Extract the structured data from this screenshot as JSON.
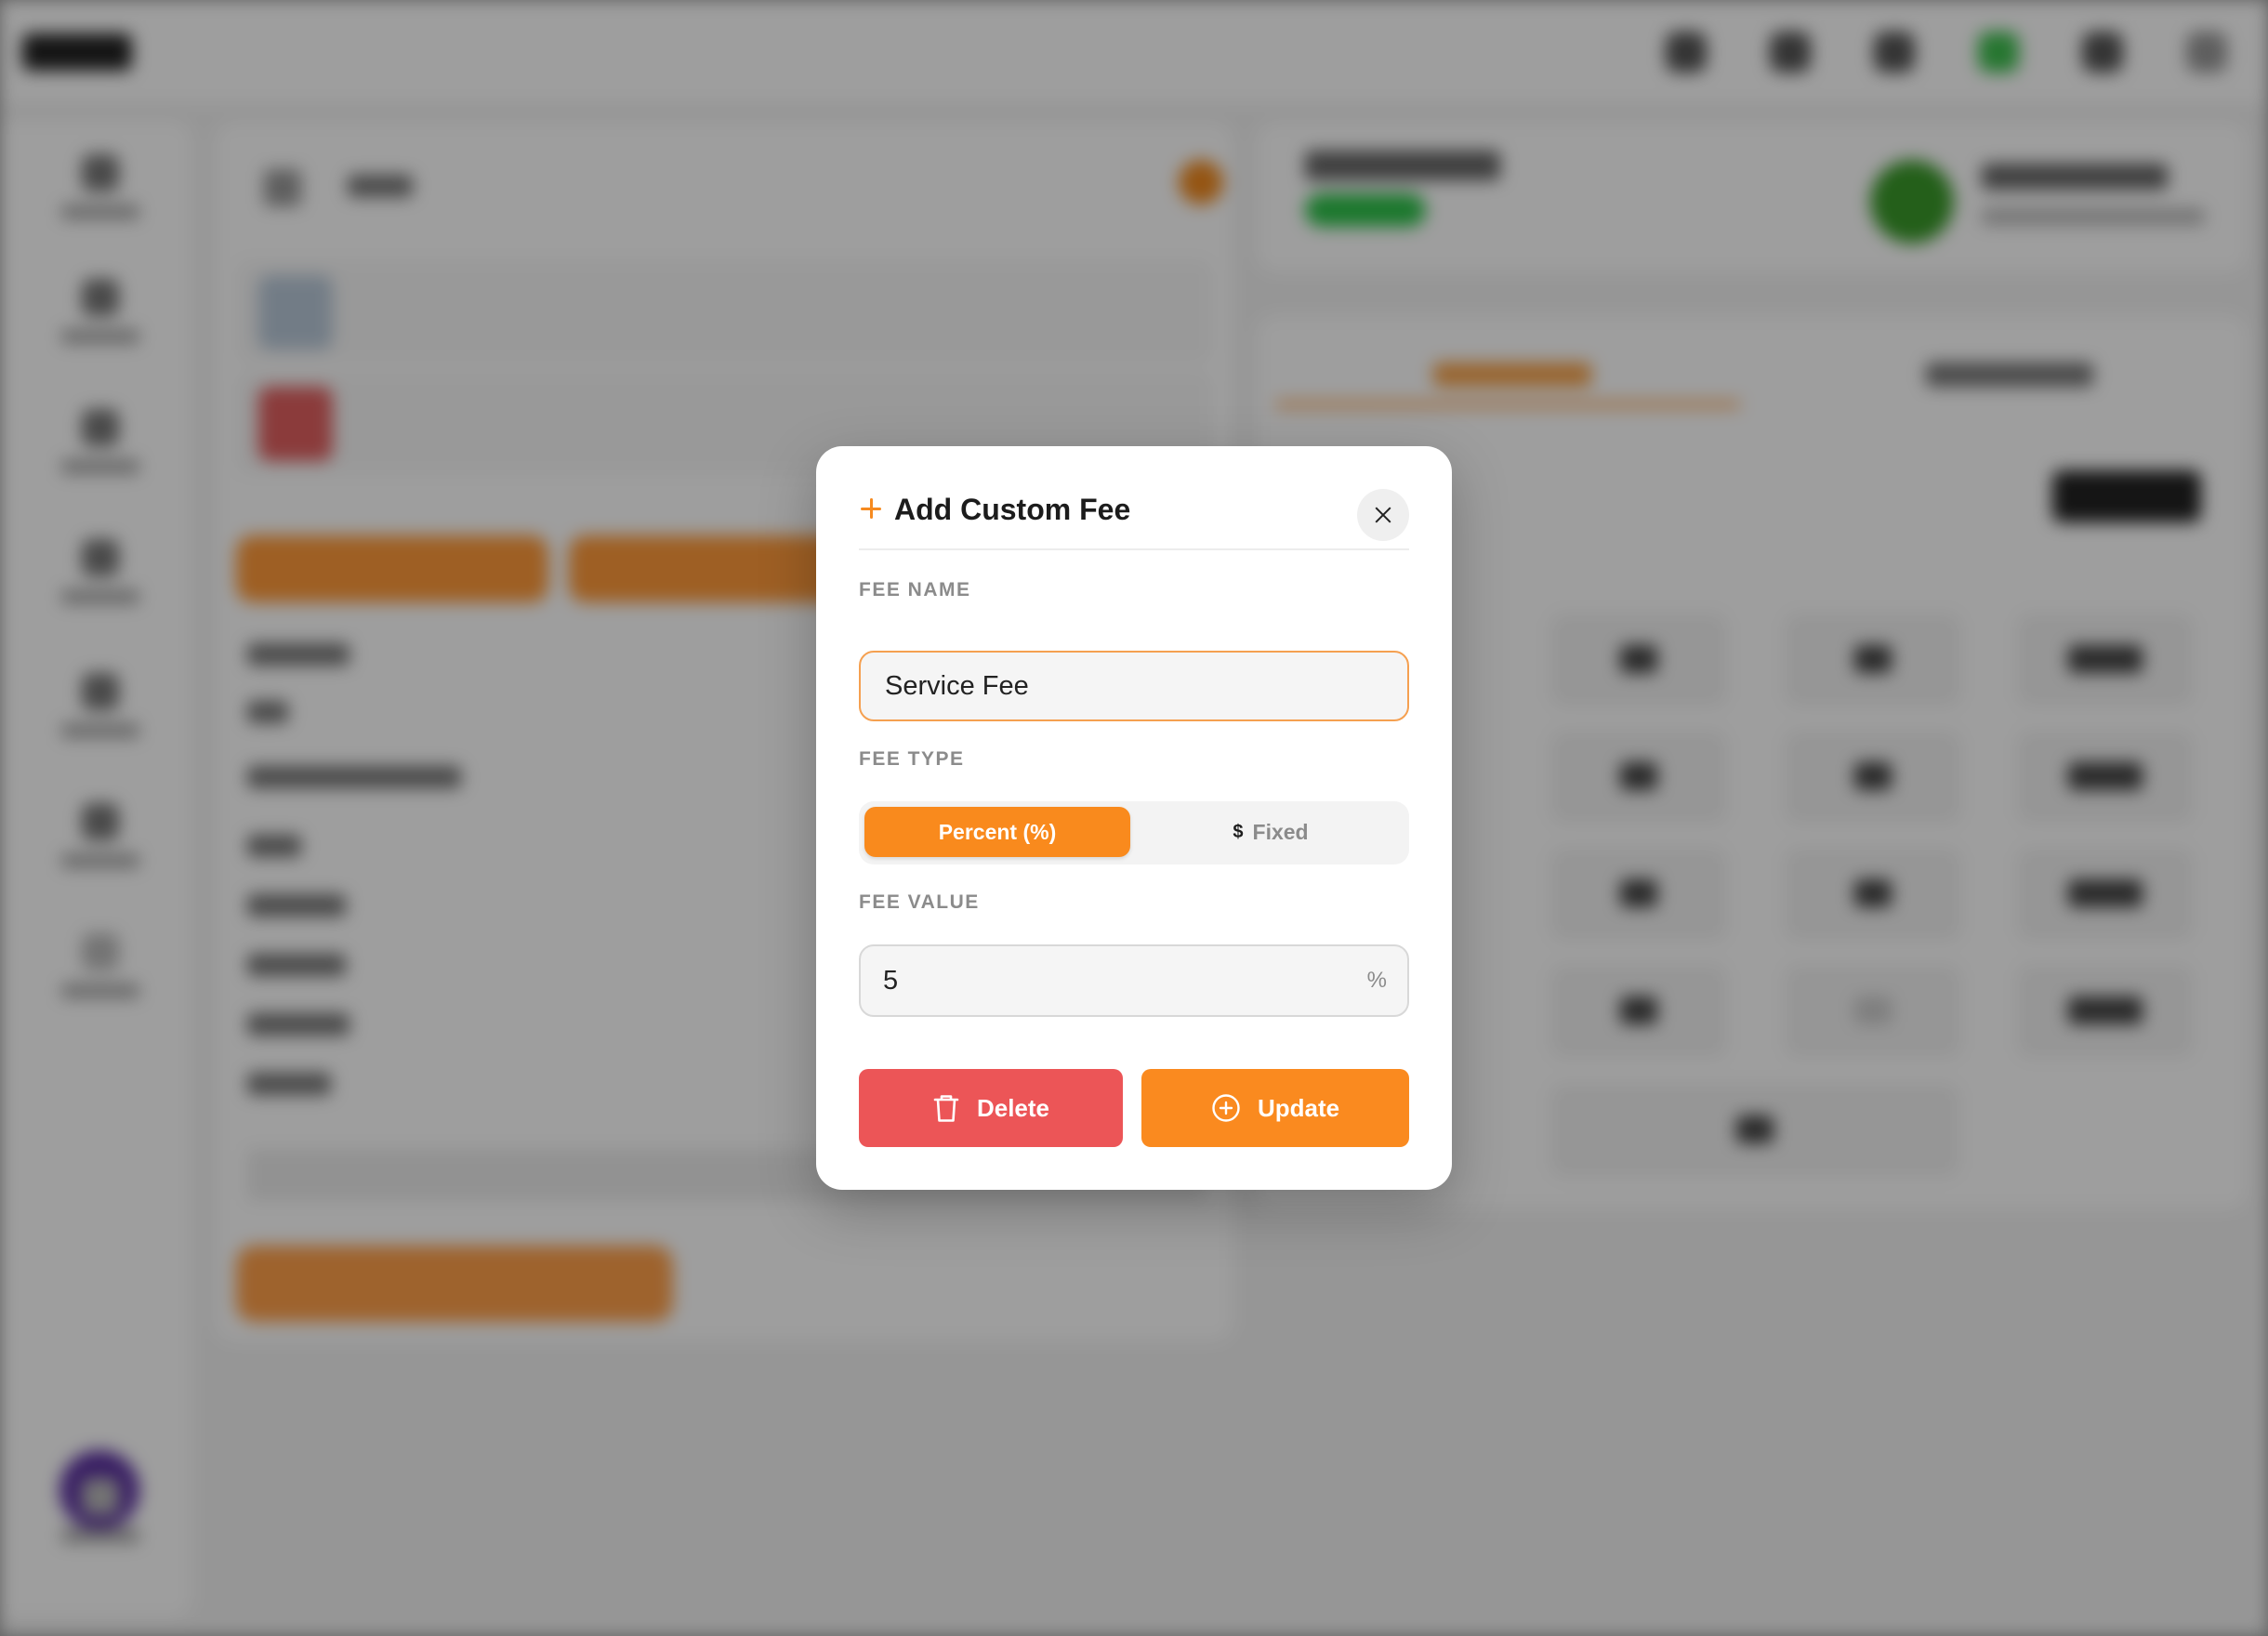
{
  "modal": {
    "title": "Add Custom Fee",
    "fee_name": {
      "label": "FEE NAME",
      "value": "Service Fee"
    },
    "fee_type": {
      "label": "FEE TYPE",
      "options": [
        {
          "label": "Percent (%)",
          "selected": true
        },
        {
          "label": "Fixed",
          "icon": "$",
          "selected": false
        }
      ]
    },
    "fee_value": {
      "label": "FEE VALUE",
      "value": "5",
      "suffix": "%"
    },
    "buttons": {
      "delete_label": "Delete",
      "update_label": "Update"
    }
  },
  "colors": {
    "accent": "#f98a1d",
    "danger": "#ec5557",
    "label_gray": "#8b8b8b"
  },
  "icons": {
    "header": "plus-icon",
    "close": "close-icon",
    "fixed": "dollar-icon",
    "delete": "trash-icon",
    "update": "plus-circle-icon"
  }
}
